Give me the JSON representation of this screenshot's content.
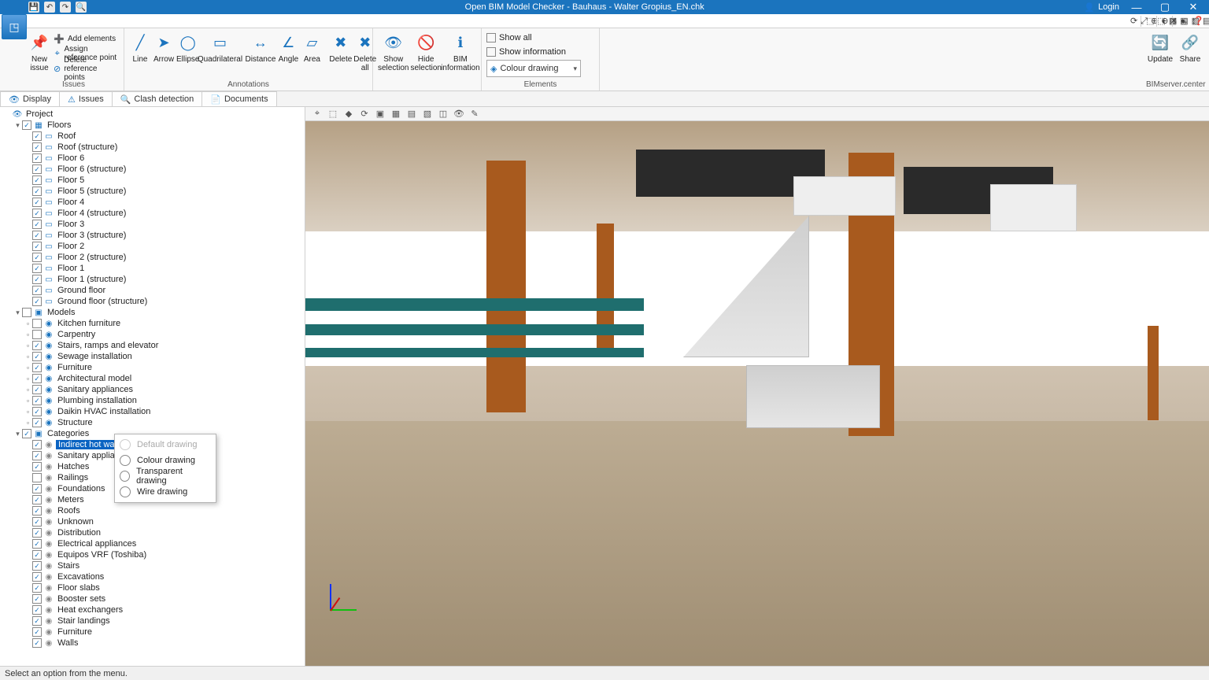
{
  "title": "Open BIM Model Checker - Bauhaus - Walter Gropius_EN.chk",
  "login_label": "Login",
  "window_buttons": {
    "minimize": "—",
    "maximize": "▢",
    "close": "✕"
  },
  "quick": [
    "💾",
    "↶",
    "↷",
    "🔍"
  ],
  "ribbon": {
    "groups": {
      "issues": {
        "label": "Issues",
        "new_issue": "New\nissue",
        "add_elements": "Add elements",
        "assign_ref": "Assign reference point",
        "delete_ref": "Delete reference points"
      },
      "annotations": {
        "label": "Annotations",
        "items": [
          "Line",
          "Arrow",
          "Ellipse",
          "Quadrilateral",
          "Distance",
          "Angle",
          "Area",
          "Delete",
          "Delete\nall"
        ]
      },
      "elements_small": {
        "items": [
          "Show\nselection",
          "Hide\nselection",
          "BIM\ninformation"
        ]
      },
      "elements": {
        "label": "Elements",
        "show_all": "Show all",
        "show_info": "Show information",
        "combo": "Colour drawing"
      },
      "bimserver": {
        "label": "BIMserver.center",
        "update": "Update",
        "share": "Share"
      }
    }
  },
  "icon_strip": [
    "⟳",
    "⤢",
    "⊕",
    "⊖",
    "⌂",
    "↔",
    "↕",
    "⬚",
    "⬚",
    "▦",
    "▧",
    "▨",
    "▤",
    "▥",
    "◫",
    "△",
    "◯",
    "◐",
    "✕",
    "●",
    "❓"
  ],
  "tabs": [
    {
      "icon": "👁",
      "label": "Display",
      "active": true
    },
    {
      "icon": "⚠",
      "label": "Issues",
      "active": false
    },
    {
      "icon": "🔍",
      "label": "Clash detection",
      "active": false
    },
    {
      "icon": "📄",
      "label": "Documents",
      "active": false
    }
  ],
  "view_toolbar": [
    "⌖",
    "⬚",
    "◆",
    "⟳",
    "▣",
    "▦",
    "▤",
    "▧",
    "◫",
    "👁",
    "✎"
  ],
  "tree": {
    "root": "Project",
    "floors_label": "Floors",
    "floors": [
      "Roof",
      "Roof (structure)",
      "Floor 6",
      "Floor 6 (structure)",
      "Floor 5",
      "Floor 5 (structure)",
      "Floor 4",
      "Floor 4 (structure)",
      "Floor 3",
      "Floor 3 (structure)",
      "Floor 2",
      "Floor 2 (structure)",
      "Floor 1",
      "Floor 1 (structure)",
      "Ground floor",
      "Ground floor (structure)"
    ],
    "models_label": "Models",
    "models": [
      {
        "name": "Kitchen furniture",
        "checked": false
      },
      {
        "name": "Carpentry",
        "checked": false
      },
      {
        "name": "Stairs, ramps and elevator",
        "checked": true
      },
      {
        "name": "Sewage installation",
        "checked": true
      },
      {
        "name": "Furniture",
        "checked": true
      },
      {
        "name": "Architectural model",
        "checked": true
      },
      {
        "name": "Sanitary appliances",
        "checked": true
      },
      {
        "name": "Plumbing installation",
        "checked": true
      },
      {
        "name": "Daikin HVAC installation",
        "checked": true
      },
      {
        "name": "Structure",
        "checked": true
      }
    ],
    "categories_label": "Categories",
    "categories": [
      {
        "name": "Indirect hot water c",
        "checked": true,
        "selected": true
      },
      {
        "name": "Sanitary appliances",
        "checked": true
      },
      {
        "name": "Hatches",
        "checked": true
      },
      {
        "name": "Railings",
        "checked": false
      },
      {
        "name": "Foundations",
        "checked": true
      },
      {
        "name": "Meters",
        "checked": true
      },
      {
        "name": "Roofs",
        "checked": true
      },
      {
        "name": "Unknown",
        "checked": true
      },
      {
        "name": "Distribution",
        "checked": true
      },
      {
        "name": "Electrical appliances",
        "checked": true
      },
      {
        "name": "Equipos VRF (Toshiba)",
        "checked": true
      },
      {
        "name": "Stairs",
        "checked": true
      },
      {
        "name": "Excavations",
        "checked": true
      },
      {
        "name": "Floor slabs",
        "checked": true
      },
      {
        "name": "Booster sets",
        "checked": true
      },
      {
        "name": "Heat exchangers",
        "checked": true
      },
      {
        "name": "Stair landings",
        "checked": true
      },
      {
        "name": "Furniture",
        "checked": true
      },
      {
        "name": "Walls",
        "checked": true
      }
    ]
  },
  "context_menu": [
    {
      "label": "Default drawing",
      "disabled": true
    },
    {
      "label": "Colour drawing",
      "disabled": false
    },
    {
      "label": "Transparent drawing",
      "disabled": false
    },
    {
      "label": "Wire drawing",
      "disabled": false
    }
  ],
  "status": "Select an option from the menu."
}
